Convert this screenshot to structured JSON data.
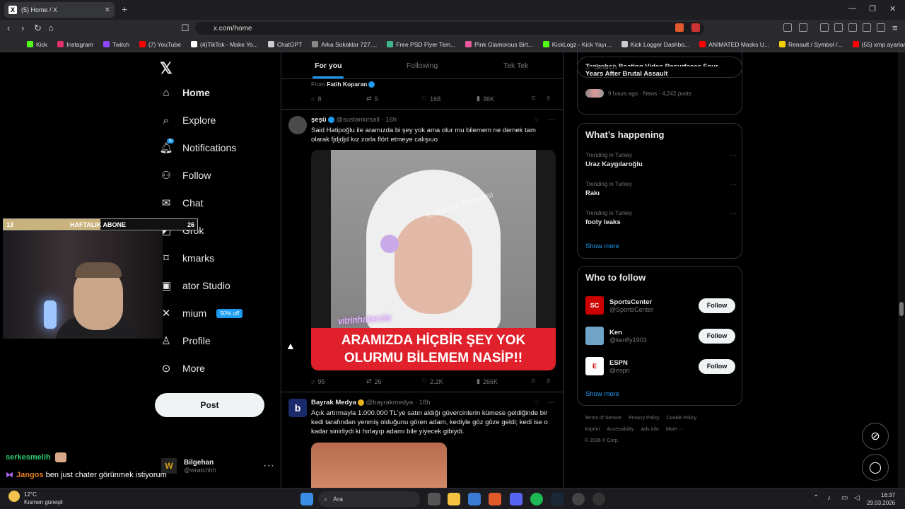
{
  "browser": {
    "tab_title": "(5) Home / X",
    "tab_close": "✕",
    "new_tab": "+",
    "url": "x.com/home",
    "bookmarks": [
      {
        "label": "Kick",
        "color": "#53fc18"
      },
      {
        "label": "Instagram",
        "color": "#e1306c"
      },
      {
        "label": "Twitch",
        "color": "#9146ff"
      },
      {
        "label": "(7) YouTube",
        "color": "#ff0000"
      },
      {
        "label": "(4)TikTok - Make Yo...",
        "color": "#ffffff"
      },
      {
        "label": "ChatGPT",
        "color": "#cccccc"
      },
      {
        "label": "Arka Sokaklar 727....",
        "color": "#888888"
      },
      {
        "label": "Free PSD Flyer Tem...",
        "color": "#3fb68b"
      },
      {
        "label": "Pink Glamorous Birt...",
        "color": "#e85a9b"
      },
      {
        "label": "KickLogz - Kick Yayı...",
        "color": "#53fc18"
      },
      {
        "label": "Kick Logger Dashbo...",
        "color": "#cccccc"
      },
      {
        "label": "ANIMATED Masks U...",
        "color": "#ff0000"
      },
      {
        "label": "Renault / Symbol /...",
        "color": "#f5d000"
      },
      {
        "label": "(55) xmp ayarları - Y...",
        "color": "#ff0000"
      }
    ]
  },
  "nav": {
    "items": [
      {
        "label": "Home",
        "icon": "home-icon"
      },
      {
        "label": "Explore",
        "icon": "search-icon"
      },
      {
        "label": "Notifications",
        "icon": "bell-icon",
        "badge": "5"
      },
      {
        "label": "Follow",
        "icon": "person-plus-icon"
      },
      {
        "label": "Chat",
        "icon": "mail-icon"
      },
      {
        "label": "Grok",
        "icon": "grok-icon"
      },
      {
        "label": "kmarks",
        "icon": "bookmark-icon"
      },
      {
        "label": "ator Studio",
        "icon": "studio-icon"
      },
      {
        "label": "mium",
        "icon": "premium-icon",
        "badge": "50% off"
      },
      {
        "label": "Profile",
        "icon": "person-icon"
      },
      {
        "label": "More",
        "icon": "more-circle-icon"
      }
    ],
    "post_label": "Post",
    "account_name": "Bilgehan",
    "account_handle": "@wratchhh"
  },
  "overlay": {
    "left_num": "13",
    "label": "HAFTALIK ABONE",
    "right_num": "26",
    "progress": 0.5
  },
  "stream_chat": [
    {
      "user": "serkesmelih",
      "text": ""
    },
    {
      "user": "Jangos",
      "text": "ben just chater görünmek istiyorum"
    }
  ],
  "timeline": {
    "tabs": [
      "For you",
      "Following",
      "Tek Tek"
    ],
    "prev_from": "From",
    "prev_author": "Fatih Koparan",
    "prev_stats": {
      "replies": "8",
      "reposts": "9",
      "likes": "168",
      "views": "36K"
    },
    "tweet1": {
      "name": "şeşü",
      "handle": "@suslankirsall · 16h",
      "text": "Said Hatipoğlu ile aramızda bi şey yok ama olur mu bilemem ne demek tam olarak fjdjdjd kız zorla flört etmeye calışıuo",
      "video_watermark": "fenomen dünyası",
      "video_tag": "vitrinhaberde",
      "video_caption_1": "ARAMIZDA HİÇBİR ŞEY YOK",
      "video_caption_2": "OLURMU BİLEMEM NASİP!!",
      "stats": {
        "replies": "95",
        "reposts": "26",
        "likes": "2.2K",
        "views": "266K"
      }
    },
    "tweet2": {
      "name": "Bayrak Medya",
      "handle": "@bayrakmedya · 18h",
      "text": "Açık artırmayla 1.000.000 TL'ye satın aldığı güvercinlerin kümese geldiğinde bir kedi tarafından yenmiş olduğunu gören adam, kediyle göz göze geldi; kedi ise o kadar sinirliydi ki hırlayıp adamı bile yiyecek gibiydi."
    }
  },
  "sidebar": {
    "search_placeholder": "Search",
    "top_headline": "Years After Brutal Assault",
    "top_headline_partial": "Tangshan Beating Video Resurfaces Four",
    "top_meta": "9 hours ago · News · 4,242 posts",
    "happening_title": "What’s happening",
    "trends": [
      {
        "meta": "Trending in Turkey",
        "title": "Uraz Kaygılaroğlu"
      },
      {
        "meta": "Trending in Turkey",
        "title": "Rakı"
      },
      {
        "meta": "Trending in Turkey",
        "title": "footy leaks"
      }
    ],
    "show_more": "Show more",
    "who_title": "Who to follow",
    "who": [
      {
        "name": "SportsCenter",
        "handle": "@SportsCenter",
        "color": "#cc0000",
        "logo": "SC"
      },
      {
        "name": "Ken",
        "handle": "@kenfly1903",
        "color": "#6fa3c7",
        "logo": ""
      },
      {
        "name": "ESPN",
        "handle": "@espn",
        "color": "#ffffff",
        "logo": "E"
      }
    ],
    "follow_label": "Follow",
    "footer": [
      "Terms of Service",
      "Privacy Policy",
      "Cookie Policy",
      "Imprint",
      "Accessibility",
      "Ads info",
      "More ···",
      "© 2026 X Corp."
    ]
  },
  "taskbar": {
    "temp": "12°C",
    "weather": "Kısmen güneşli",
    "search_label": "Ara",
    "time": "16:37",
    "date": "29.03.2026"
  }
}
